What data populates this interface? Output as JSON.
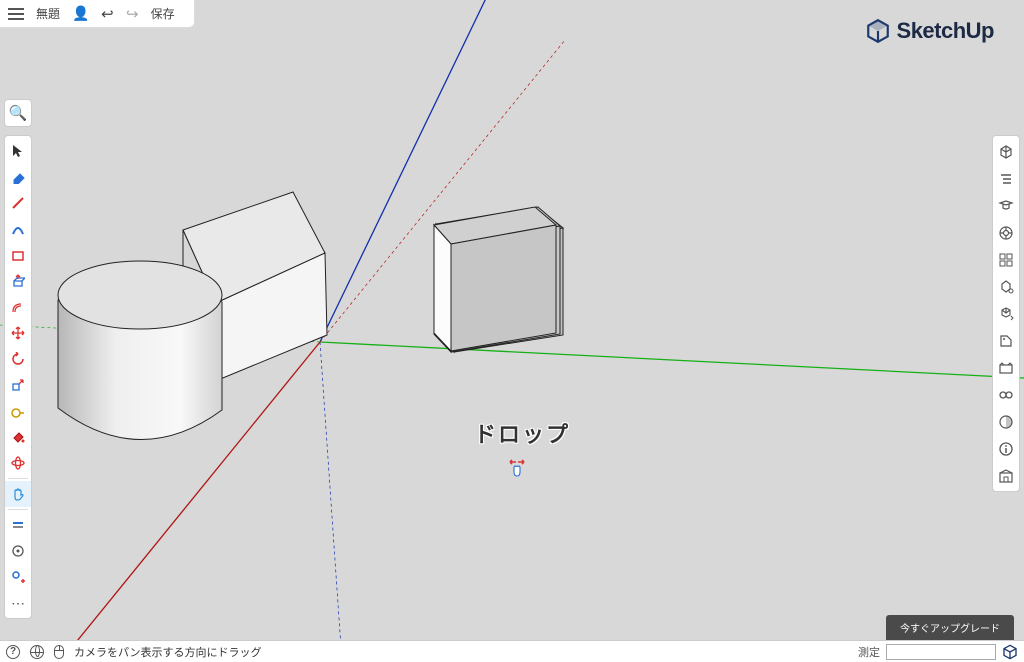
{
  "app": {
    "title": "無題",
    "menu_save": "保存",
    "brand": "SketchUp"
  },
  "viewport": {
    "drop_label": "ドロップ"
  },
  "left_tools": {
    "select": "select-tool",
    "eraser": "eraser-tool",
    "line": "line-tool",
    "arc": "arc-tool",
    "rectangle": "shapes-tool",
    "pushpull": "push-pull-tool",
    "offset": "offset-tool",
    "move": "move-tool",
    "rotate": "rotate-tool",
    "scale": "scale-tool",
    "tape": "tape-measure-tool",
    "text": "text-tool",
    "paint": "paint-bucket-tool",
    "orbit": "orbit-tool",
    "pan": "pan-tool",
    "walk": "walk-tool",
    "section": "section-tool",
    "more": "more-tools"
  },
  "right_tools": {
    "entity": "entity-info-panel",
    "outliner": "outliner-panel",
    "instructor": "instructor-panel",
    "components": "components-panel",
    "materials": "materials-panel",
    "styles": "styles-panel",
    "tags": "tags-panel",
    "scenes": "scenes-panel",
    "shadows": "display-panel",
    "softedges": "views-panel",
    "fog": "fog-panel",
    "info": "model-info-panel",
    "warehouse": "3d-warehouse-panel"
  },
  "status": {
    "hint": "カメラをパン表示する方向にドラッグ",
    "measure_label": "測定",
    "measure_value": ""
  },
  "upgrade": {
    "label": "今すぐアップグレード"
  }
}
